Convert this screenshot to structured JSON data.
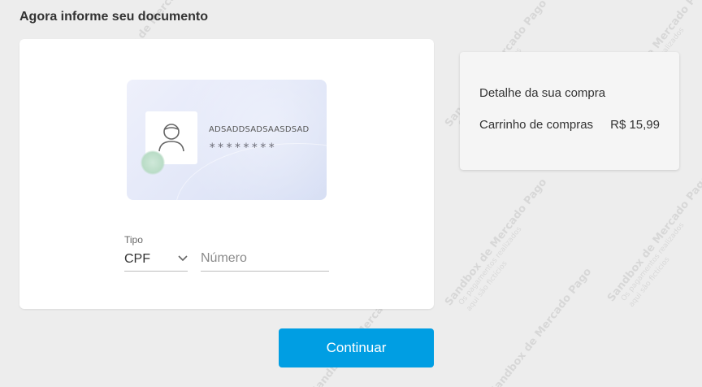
{
  "page": {
    "title": "Agora informe seu documento"
  },
  "document_card": {
    "holder_name": "ADSADDSADSAASDSAD",
    "masked_number": "********",
    "avatar_icon": "person-icon"
  },
  "form": {
    "tipo_label": "Tipo",
    "tipo_value": "CPF",
    "numero_placeholder": "Número",
    "numero_value": ""
  },
  "summary": {
    "title": "Detalhe da sua compra",
    "item_label": "Carrinho de compras",
    "item_value": "R$ 15,99"
  },
  "actions": {
    "continue_label": "Continuar"
  },
  "watermark": {
    "main": "Sandbox de Mercado Pago",
    "line1": "Os pagamentos realizados",
    "line2": "aqui são fictícios"
  },
  "colors": {
    "primary_button": "#009ee3",
    "background": "#ededed"
  }
}
